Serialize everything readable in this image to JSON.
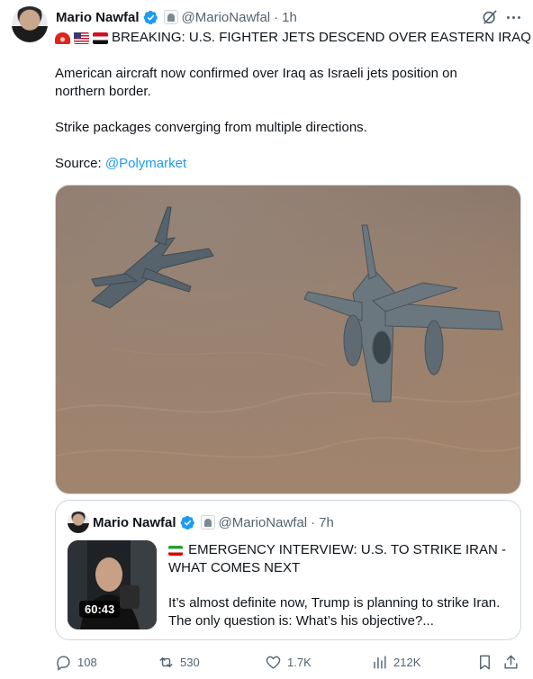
{
  "tweet": {
    "author_name": "Mario Nawfal",
    "handle": "@MarioNawfal",
    "separator": "·",
    "time": "1h",
    "headline": "BREAKING: U.S. FIGHTER JETS DESCEND OVER EASTERN IRAQ",
    "headline_emojis": [
      "siren",
      "us-flag",
      "iraq-flag"
    ],
    "paragraph1": "American aircraft now confirmed over Iraq as Israeli jets position on northern border.",
    "paragraph2": "Strike packages converging from multiple directions.",
    "source_prefix": "Source: ",
    "source_link": "@Polymarket"
  },
  "quoted_tweet": {
    "author_name": "Mario Nawfal",
    "handle": "@MarioNawfal",
    "separator": "·",
    "time": "7h",
    "title": "EMERGENCY INTERVIEW: U.S. TO STRIKE IRAN - WHAT COMES NEXT",
    "title_emoji": "iran-flag",
    "body": "It’s almost definite now, Trump is planning to strike Iran. The only question is: What’s his objective?...",
    "video_duration": "60:43"
  },
  "actions": {
    "replies": "108",
    "reposts": "530",
    "likes": "1.7K",
    "views": "212K"
  },
  "colors": {
    "text": "#0f1419",
    "secondary": "#536471",
    "link": "#1d9bf0",
    "verified": "#1d9bf0",
    "border": "#cfd9de"
  }
}
